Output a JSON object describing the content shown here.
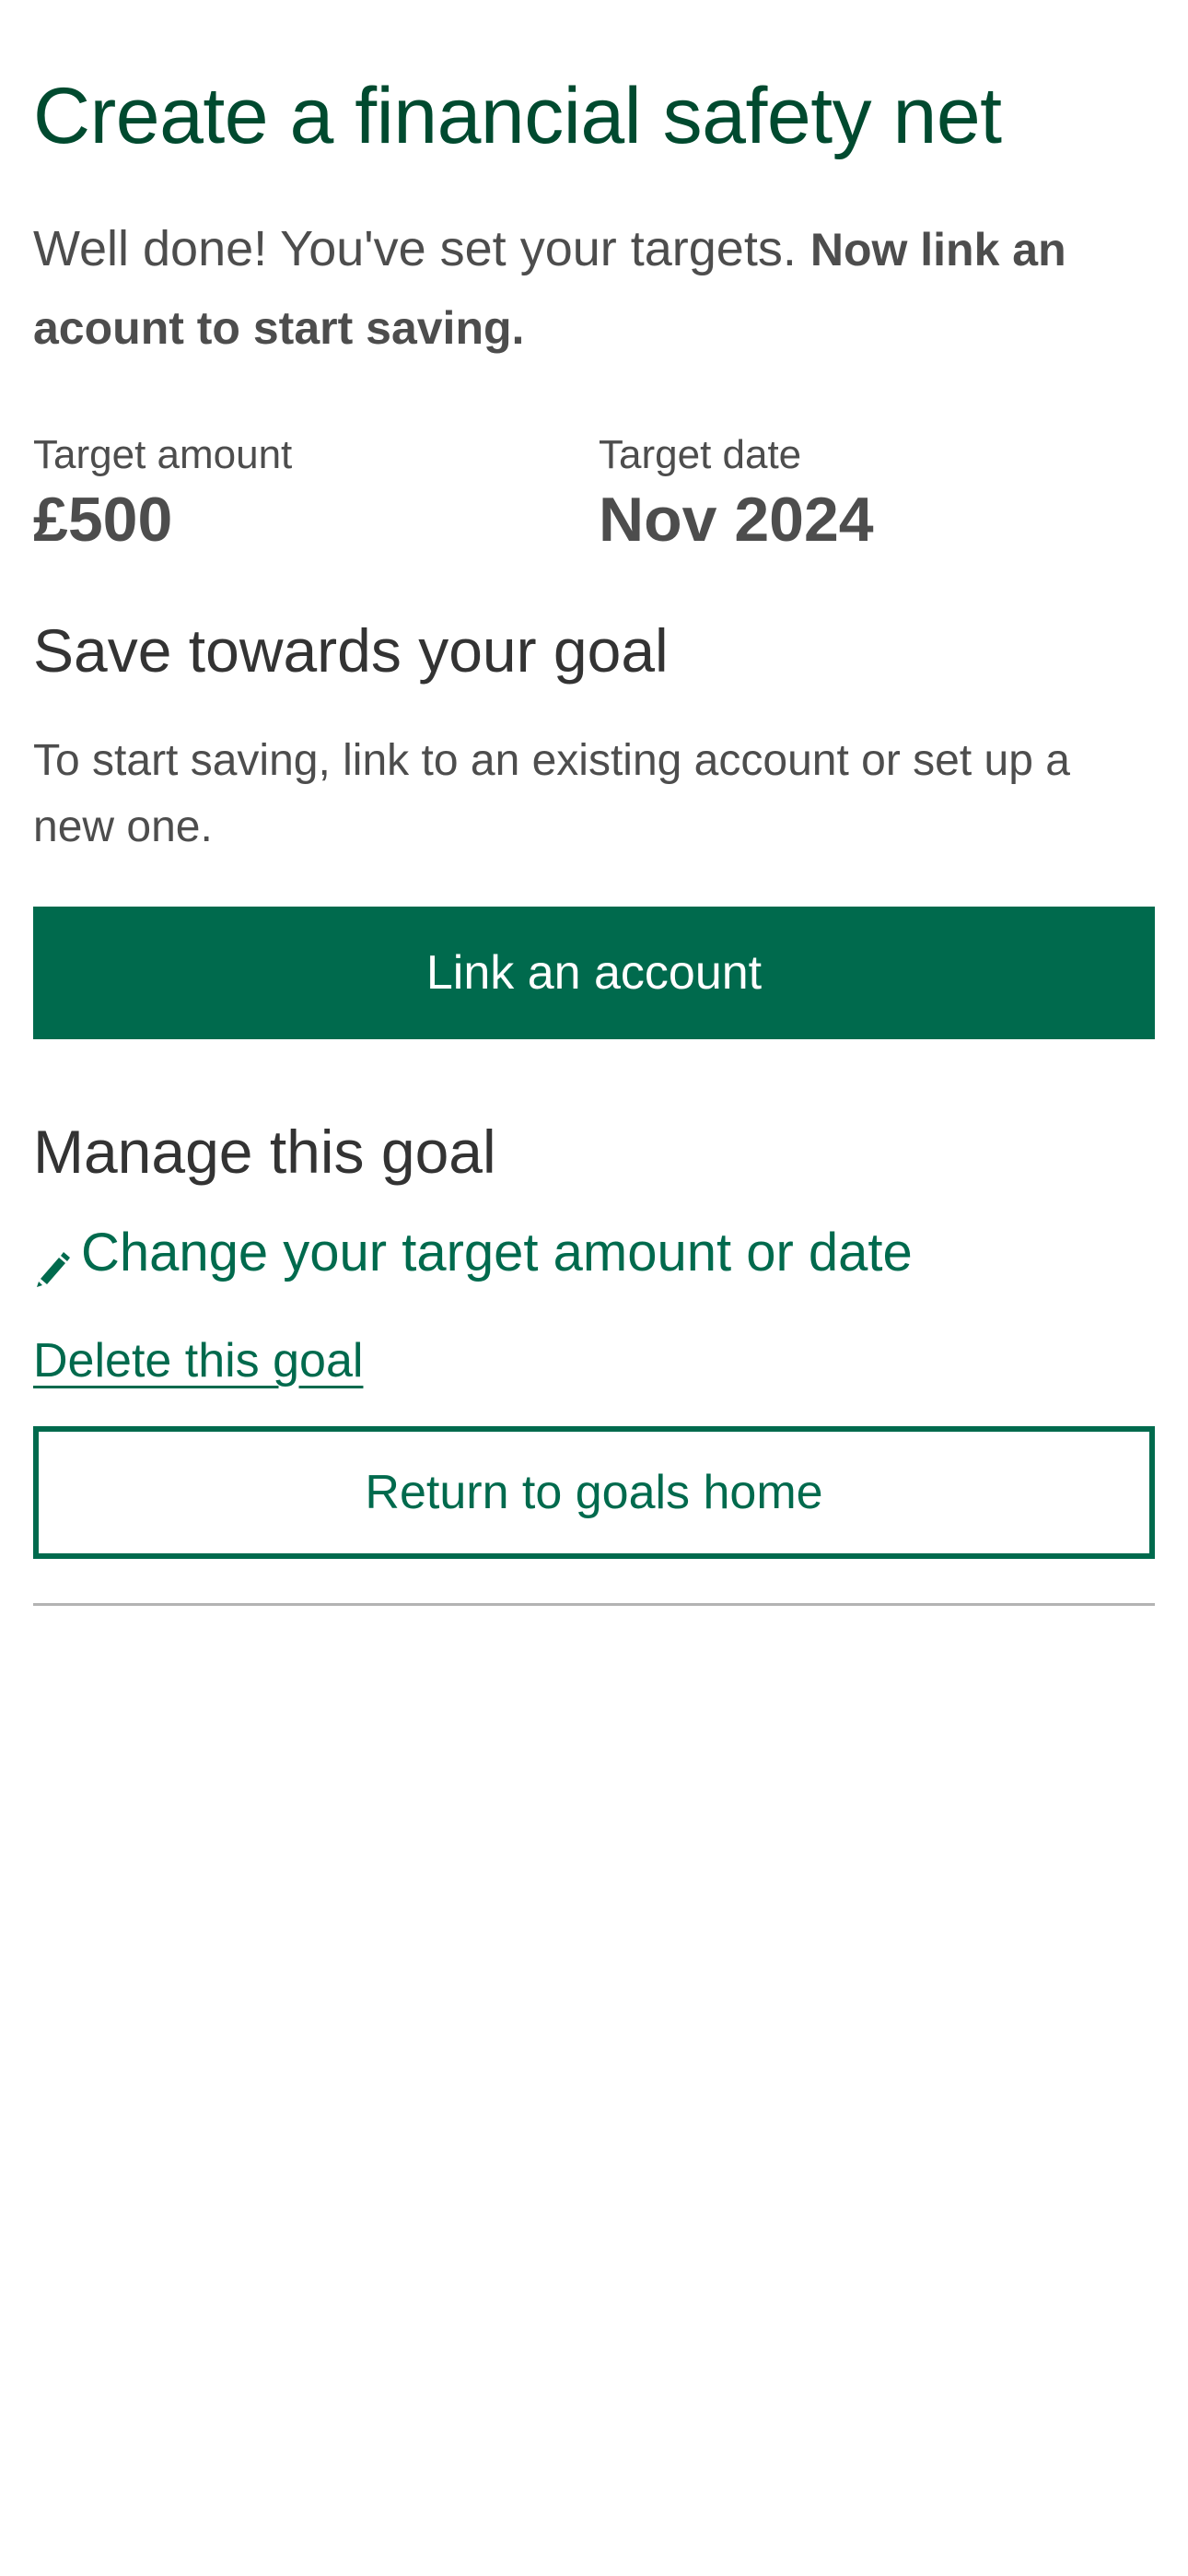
{
  "page": {
    "title": "Create a financial safety net",
    "intro_text": "Well done! You've set your targets. ",
    "intro_bold": "Now link an acount to start saving."
  },
  "targets": {
    "amount_label": "Target amount",
    "amount_value": "£500",
    "date_label": "Target date",
    "date_value": "Nov 2024"
  },
  "save_section": {
    "heading": "Save towards your goal",
    "body": "To start saving, link to an existing account or set up a new one.",
    "link_account_button": "Link an account"
  },
  "manage_section": {
    "heading": "Manage this goal",
    "change_link": "Change your target amount or date",
    "change_icon": "pencil-icon",
    "delete_link": "Delete this goal",
    "return_button": "Return to goals home"
  },
  "colors": {
    "brand_green": "#006a4d",
    "title_green": "#004a2f",
    "text_grey": "#4d4d4d",
    "divider": "#b3b3b3"
  }
}
